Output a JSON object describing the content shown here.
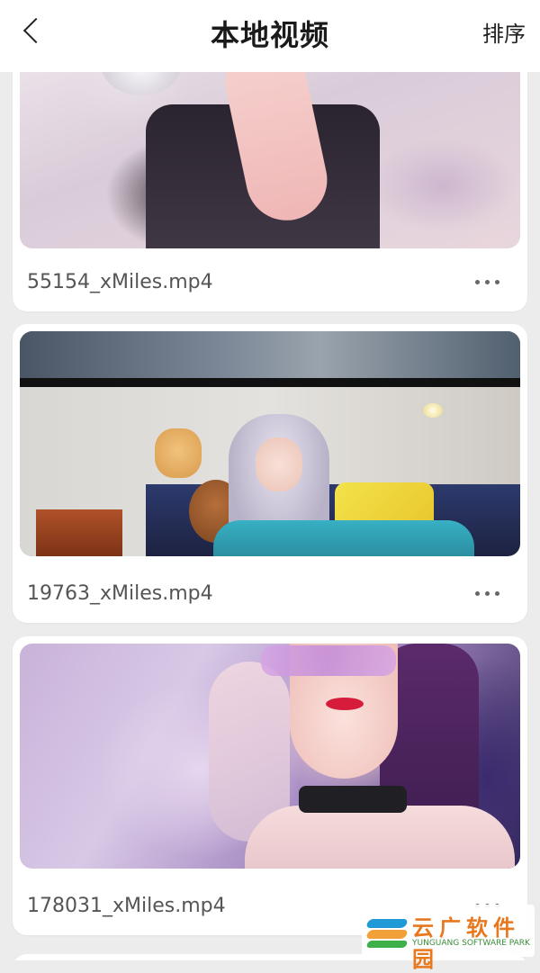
{
  "header": {
    "title": "本地视频",
    "sort_label": "排序"
  },
  "videos": [
    {
      "filename": "55154_xMiles.mp4"
    },
    {
      "filename": "19763_xMiles.mp4"
    },
    {
      "filename": "178031_xMiles.mp4"
    }
  ],
  "watermark": {
    "cn": "云广软件园",
    "en": "YUNGUANG SOFTWARE PARK"
  }
}
